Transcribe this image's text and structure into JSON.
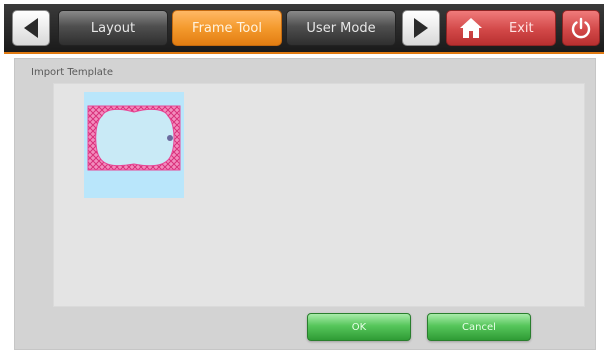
{
  "toolbar": {
    "prev_icon": "left-arrow-icon",
    "tabs": [
      {
        "label": "Layout",
        "state": "normal"
      },
      {
        "label": "Frame Tool",
        "state": "active"
      },
      {
        "label": "User Mode",
        "state": "normal"
      }
    ],
    "next_icon": "right-arrow-icon",
    "exit": {
      "label": "Exit",
      "icon": "home-icon"
    },
    "power_icon": "power-icon"
  },
  "panel": {
    "title": "Import Template",
    "templates": [
      {
        "name": "pink-heart-frame",
        "selected": true
      }
    ]
  },
  "buttons": {
    "ok": "OK",
    "cancel": "Cancel"
  },
  "colors": {
    "toolbar_bg": "#222222",
    "accent_orange": "#f49a2d",
    "exit_red": "#d24848",
    "ok_green": "#56c65b",
    "thumb_bg": "#b9e6fb",
    "frame_pink": "#e8408e"
  }
}
